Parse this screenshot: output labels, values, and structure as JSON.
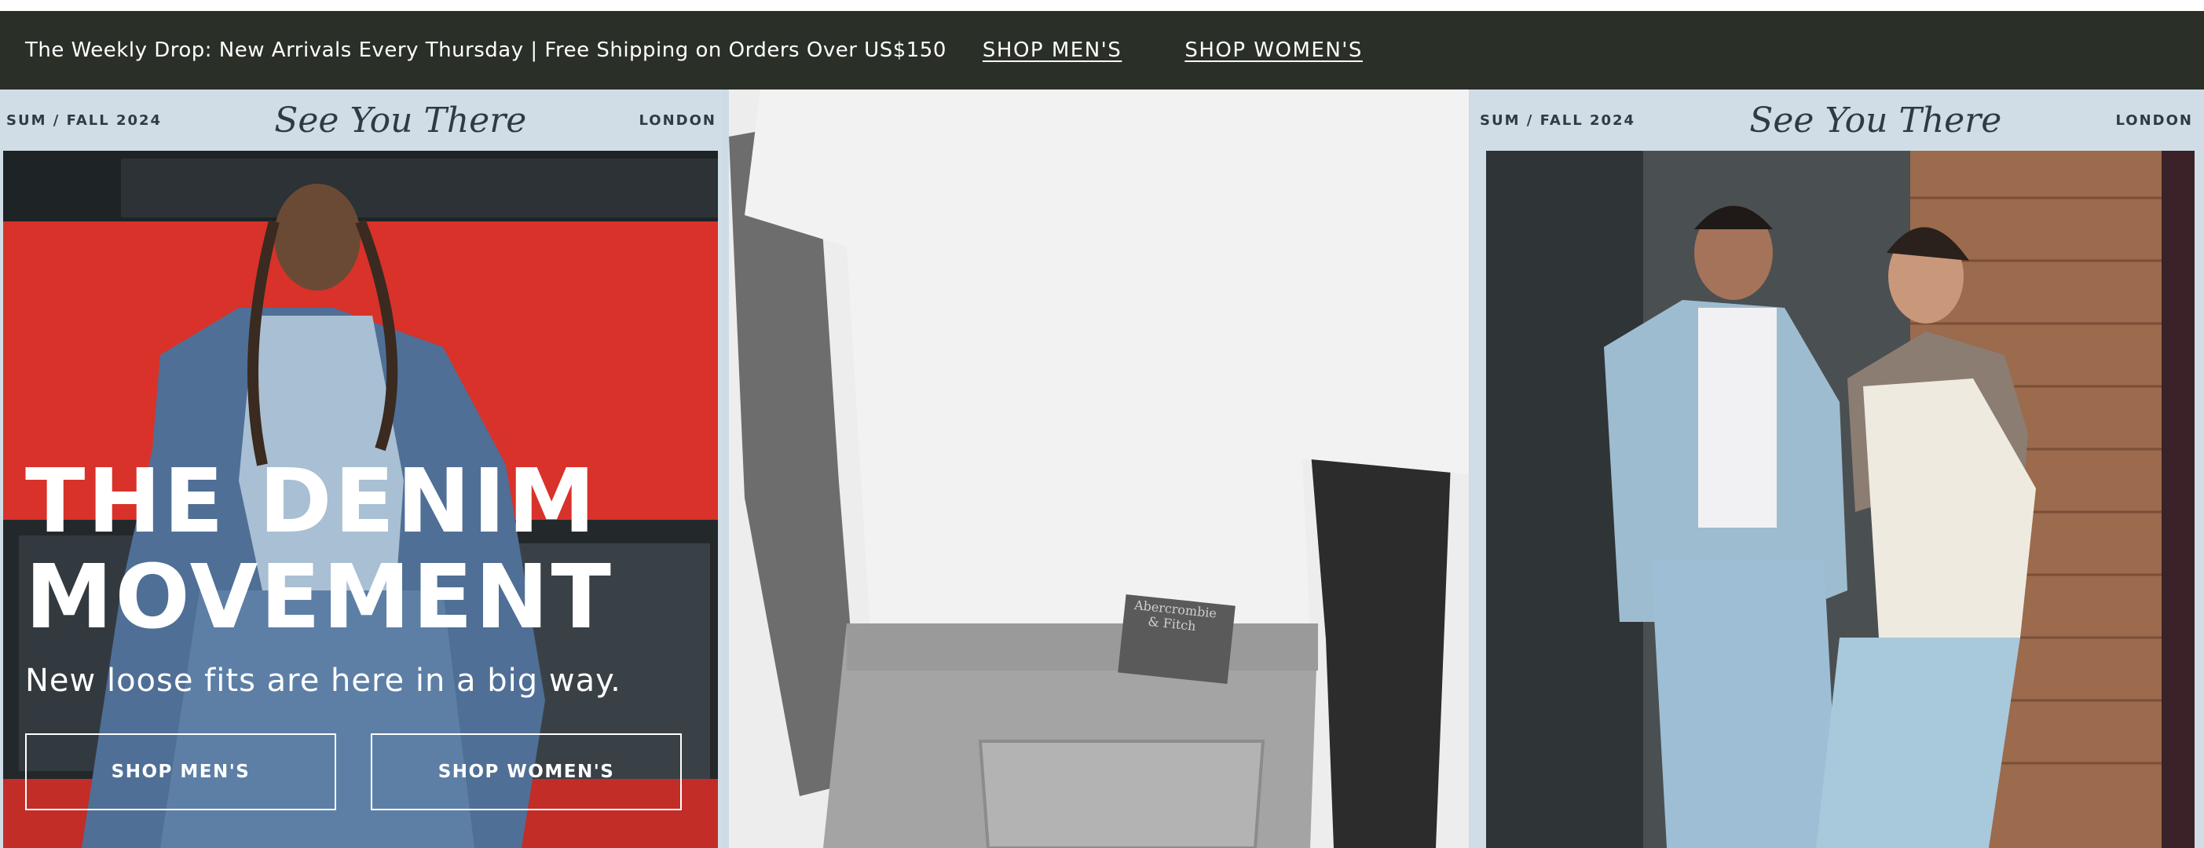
{
  "promo_bar": {
    "message": "The Weekly Drop: New Arrivals Every Thursday | Free Shipping on Orders Over US$150",
    "shop_mens": "SHOP MEN'S",
    "shop_womens": "SHOP WOMEN'S",
    "background": "#2a3027"
  },
  "hero": {
    "panels": [
      {
        "season": "SUM / FALL 2024",
        "tagline": "See You There",
        "city": "LONDON"
      },
      {
        "season": "SUM / FALL 2024",
        "tagline": "See You There",
        "city": "LONDON"
      }
    ],
    "headline_line1": "THE DENIM",
    "headline_line2": "MOVEMENT",
    "subheadline": "New loose fits are here in a big way.",
    "cta_mens": "SHOP MEN'S",
    "cta_womens": "SHOP WOMEN'S",
    "jeans_label": "Abercrombie & Fitch"
  },
  "colors": {
    "bus_red": "#d8322a",
    "denim": "#4f6f96",
    "campaign_bg": "#d0dde6",
    "text_dark": "#2f3a44"
  }
}
